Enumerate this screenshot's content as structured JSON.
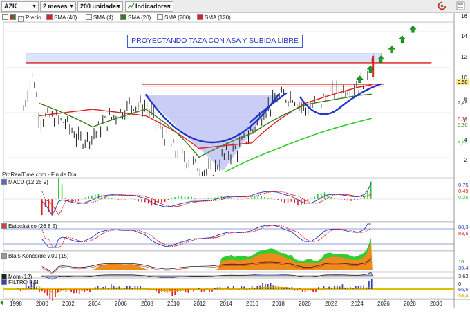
{
  "toolbar": {
    "symbol": "AZK",
    "period": "2 meses",
    "units": "200 unidades",
    "indicators": "Indicadores"
  },
  "legend": [
    {
      "label": "Precio",
      "color": "#ffffff"
    },
    {
      "label": "SMA (40)",
      "color": "#e02020"
    },
    {
      "label": "SMA (4)",
      "color": "#ffffff"
    },
    {
      "label": "SMA (20)",
      "color": "#3a7a1e"
    },
    {
      "label": "SMA (200)",
      "color": "#ffffff"
    },
    {
      "label": "SMA (120)",
      "color": "#e02020"
    }
  ],
  "annotation": "PROYECTANDO TAZA CON ASA Y SUBIDA LIBRE",
  "source_text": "ProRealTime.com - Fin de Día",
  "panels": {
    "macd": "MACD (12 26 9)",
    "stoch": "Estocástico (26 8 5)",
    "koncorde": "Blai5 Koncorde v.09 (15)",
    "mom": "Mom (12)",
    "rsi": "FILTRO RSI"
  },
  "price_axis": [
    "16",
    "14",
    "12",
    "10",
    "8",
    "6",
    "4",
    "2"
  ],
  "price_labels": [
    {
      "text": "9,58",
      "bg": "#ffe680",
      "color": "#000000"
    },
    {
      "text": "7,49",
      "bg": "#ffffff",
      "color": "#333333"
    },
    {
      "text": "6,12",
      "bg": "#ffffff",
      "color": "#e02020"
    },
    {
      "text": "5,30",
      "bg": "#ffffff",
      "color": "#3a7a1e"
    },
    {
      "text": "3,65",
      "bg": "#ffffff",
      "color": "#2ecc2e"
    }
  ],
  "macd_labels": [
    {
      "text": "0,75",
      "color": "#3040c0"
    },
    {
      "text": "0,49",
      "color": "#e02020"
    },
    {
      "text": "0,26",
      "color": "#2ecc2e"
    }
  ],
  "stoch_labels": [
    {
      "text": "88,3",
      "color": "#3040c0"
    },
    {
      "text": "83,5",
      "color": "#e02020"
    }
  ],
  "koncorde_labels": [
    {
      "text": "10",
      "color": "#2a8a2a"
    },
    {
      "text": "39,4",
      "color": "#3040c0"
    }
  ],
  "mom_labels": [
    {
      "text": "3,62",
      "color": "#222222"
    },
    {
      "text": "0",
      "color": "#222222"
    }
  ],
  "rsi_labels": [
    {
      "text": "66,5",
      "color": "#3040c0"
    },
    {
      "text": "58,4",
      "color": "#e0a000"
    }
  ],
  "x_axis": [
    "1998",
    "2000",
    "2002",
    "2004",
    "2006",
    "2008",
    "2010",
    "2012",
    "2014",
    "2016",
    "2018",
    "2020",
    "2022",
    "2024",
    "2026",
    "2028",
    "2030"
  ],
  "chart_data": {
    "type": "line",
    "title": "PROYECTANDO TAZA CON ASA Y SUBIDA LIBRE",
    "symbol": "AZK",
    "x_range": [
      1998,
      2030
    ],
    "y_range": [
      0,
      16
    ],
    "y_scale": "log",
    "last_price": 9.58,
    "resistance_level": 8.6,
    "neckline_level": 6.1,
    "series": [
      {
        "name": "Precio",
        "x": [
          1998.8,
          1999.5,
          2000,
          2001,
          2002,
          2003,
          2004,
          2005,
          2006,
          2007,
          2008,
          2009,
          2010,
          2011,
          2012,
          2013,
          2014,
          2015,
          2016,
          2017,
          2018,
          2019,
          2020,
          2021,
          2022,
          2023,
          2024,
          2024.6,
          2025
        ],
        "values": [
          4.2,
          7.2,
          3.7,
          3.7,
          3.4,
          2.6,
          2.8,
          3.5,
          4.0,
          4.6,
          4.4,
          3.2,
          2.3,
          2.0,
          1.7,
          1.6,
          2.1,
          2.3,
          3.0,
          4.2,
          5.0,
          5.2,
          4.2,
          4.6,
          5.4,
          5.8,
          6.1,
          7.0,
          9.58
        ]
      },
      {
        "name": "SMA (40)",
        "x": [
          2000,
          2004,
          2008,
          2012,
          2016,
          2020,
          2024,
          2025
        ],
        "values": [
          3.8,
          4.2,
          3.8,
          2.3,
          2.5,
          4.6,
          5.9,
          6.12
        ]
      },
      {
        "name": "SMA (20)",
        "x": [
          2000,
          2004,
          2008,
          2012,
          2016,
          2020,
          2024,
          2025
        ],
        "values": [
          4.6,
          3.2,
          4.2,
          2.0,
          2.9,
          4.5,
          5.2,
          5.3
        ]
      },
      {
        "name": "SMA (120)",
        "x": [
          2014,
          2018,
          2022,
          2025
        ],
        "values": [
          1.6,
          2.3,
          3.1,
          3.65
        ]
      }
    ],
    "projection_arrows": [
      2026,
      2026.8,
      2027.6,
      2028.4,
      2029.2,
      2030
    ],
    "indicators": {
      "MACD (12 26 9)": {
        "macd": 0.75,
        "signal": 0.49,
        "histogram": 0.26
      },
      "Estocástico (26 8 5)": {
        "k": 88.3,
        "d": 83.5
      },
      "Blai5 Koncorde v.09 (15)": {
        "value1": 10,
        "value2": 39.4
      },
      "Mom (12)": {
        "value": 3.62,
        "zero": 0
      },
      "FILTRO RSI": {
        "rsi": 66.5,
        "signal": 58.4
      }
    }
  }
}
